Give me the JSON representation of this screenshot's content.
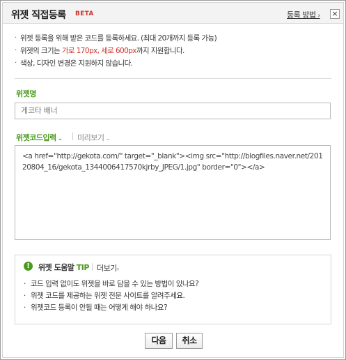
{
  "header": {
    "title": "위젯 직접등록",
    "badge": "BETA",
    "help_link": "등록 방법",
    "help_link_mark": "›",
    "close_label": "×"
  },
  "notices": [
    {
      "parts": [
        {
          "text": "위젯 등록을 위해 받은 코드를 등록하세요. (최대 20개까지 등록 가능)",
          "highlight": false
        }
      ]
    },
    {
      "parts": [
        {
          "text": "위젯의 크기는 ",
          "highlight": false
        },
        {
          "text": "가로 170px, 세로 600px",
          "highlight": true
        },
        {
          "text": "까지 지원합니다.",
          "highlight": false
        }
      ]
    },
    {
      "parts": [
        {
          "text": "색상, 디자인 변경은 지원하지 않습니다.",
          "highlight": false
        }
      ]
    }
  ],
  "form": {
    "name_label": "위젯명",
    "name_value": "게코타 배너",
    "code_tab_label": "위젯코드입력",
    "preview_tab_label": "미리보기",
    "code_value": "<a href=\"http://gekota.com/\" target=\"_blank\"><img src=\"http://blogfiles.naver.net/20120804_16/gekota_1344006417570kjrby_JPEG/1.jpg\" border=\"0\"></a>"
  },
  "tip": {
    "icon_glyph": "!",
    "title": "위젯 도움말",
    "tag": "TIP",
    "more_label": "더보기",
    "more_mark": "›",
    "bullet": "·",
    "items": [
      "코드 입력 없이도 위젯을 바로 담을 수 있는 방법이 있나요?",
      "위젯 코드를 제공하는 위젯 전문 사이트를 알려주세요.",
      "위젯코드 등록이 안될 때는 어떻게 해야 하나요?"
    ]
  },
  "buttons": {
    "next_label": "다음",
    "cancel_label": "취소"
  },
  "colors": {
    "accent_green": "#4a9a1e",
    "highlight_red": "#d0342c"
  },
  "icons": {
    "tab_chevron": "chevron-down-icon",
    "tip_icon": "exclamation-icon"
  }
}
